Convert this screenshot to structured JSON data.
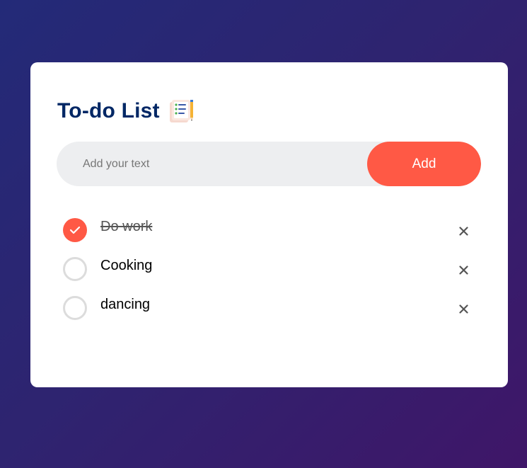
{
  "app": {
    "title": "To-do List",
    "title_icon": "checklist-notepad-pencil-icon"
  },
  "input": {
    "placeholder": "Add your text",
    "value": "",
    "add_label": "Add"
  },
  "todos": [
    {
      "text": "Do work",
      "done": true
    },
    {
      "text": "Cooking",
      "done": false
    },
    {
      "text": "dancing",
      "done": false
    }
  ],
  "colors": {
    "accent": "#ff5945",
    "title": "#002765",
    "input_bg": "#edeef0",
    "bg_start": "#232a78",
    "bg_end": "#3f1668"
  }
}
